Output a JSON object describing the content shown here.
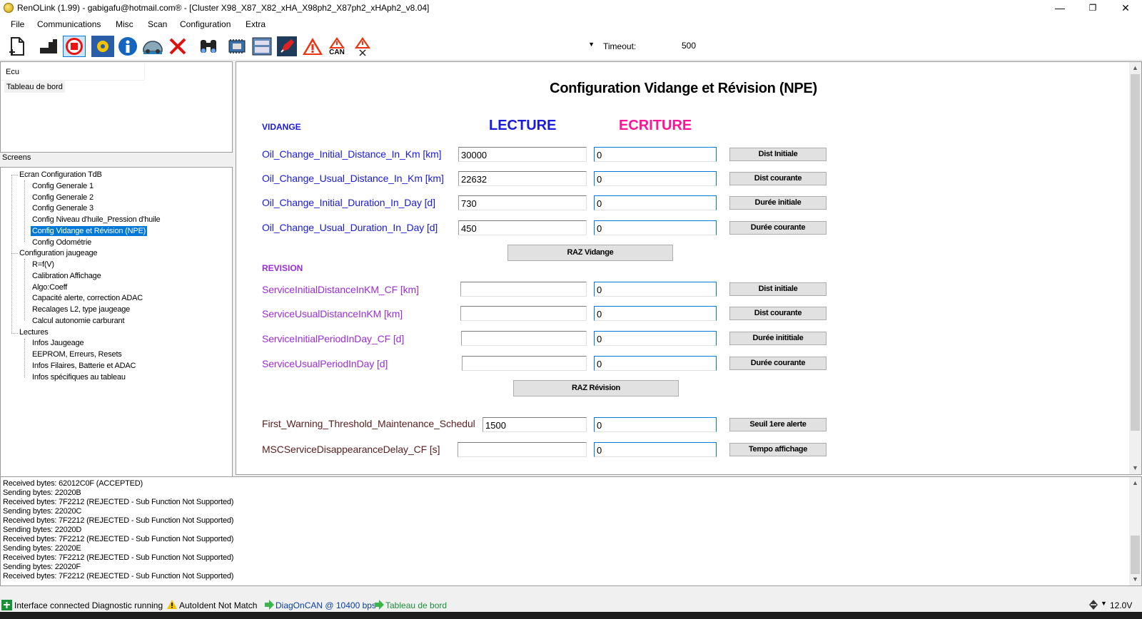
{
  "window": {
    "title": "RenOLink (1.99) - gabigafu@hotmail.com® - [Cluster X98_X87_X82_xHA_X98ph2_X87ph2_xHAph2_v8.04]",
    "minimize": "—",
    "maximize": "❐",
    "close": "✕"
  },
  "menu": [
    "File",
    "Communications",
    "Misc",
    "Scan",
    "Configuration",
    "Extra"
  ],
  "toolbar": {
    "can_label": "CAN",
    "timeout_label": "Timeout:",
    "timeout_value": "500",
    "select_value": ""
  },
  "ecu": {
    "header": "Ecu",
    "row": "Tableau de bord"
  },
  "screens": {
    "label": "Screens",
    "tree": {
      "g1": "Ecran Configuration TdB",
      "g1_items": [
        "Config Generale 1",
        "Config Generale 2",
        "Config Generale 3",
        "Config Niveau d'huile_Pression d'huile",
        "Config Vidange et Révision (NPE)",
        "Config Odométrie"
      ],
      "g2": "Configuration jaugeage",
      "g2_items": [
        "R=f(V)",
        "Calibration Affichage",
        "Algo:Coeff",
        "Capacité alerte, correction ADAC",
        "Recalages L2, type jaugeage",
        "Calcul autonomie carburant"
      ],
      "g3": "Lectures",
      "g3_items": [
        "Infos Jaugeage",
        "EEPROM, Erreurs, Resets",
        "Infos Filaires, Batterie et ADAC",
        "Infos spécifiques au tableau"
      ]
    }
  },
  "form": {
    "title": "Configuration Vidange et Révision (NPE)",
    "vidange_label": "VIDANGE",
    "lecture": "LECTURE",
    "ecriture": "ECRITURE",
    "revision_label": "REVISION",
    "oil": [
      {
        "name": "Oil_Change_Initial_Distance_In_Km [km]",
        "read": "30000",
        "write": "0",
        "button": "Dist Initiale"
      },
      {
        "name": "Oil_Change_Usual_Distance_In_Km [km]",
        "read": "22632",
        "write": "0",
        "button": "Dist courante"
      },
      {
        "name": "Oil_Change_Initial_Duration_In_Day [d]",
        "read": "730",
        "write": "0",
        "button": "Durée initiale"
      },
      {
        "name": "Oil_Change_Usual_Duration_In_Day [d]",
        "read": "450",
        "write": "0",
        "button": "Durée courante"
      }
    ],
    "raz_vidange": "RAZ Vidange",
    "service": [
      {
        "name": "ServiceInitialDistanceInKM_CF [km]",
        "read": "",
        "write": "0",
        "button": "Dist initiale"
      },
      {
        "name": "ServiceUsualDistanceInKM [km]",
        "read": "",
        "write": "0",
        "button": "Dist courante"
      },
      {
        "name": "ServiceInitialPeriodInDay_CF [d]",
        "read": "",
        "write": "0",
        "button": "Durée inititiale"
      },
      {
        "name": "ServiceUsualPeriodInDay [d]",
        "read": "",
        "write": "0",
        "button": "Durée courante"
      }
    ],
    "raz_revision": "RAZ Révision",
    "other": [
      {
        "name": "First_Warning_Threshold_Maintenance_Schedul",
        "read": "1500",
        "write": "0",
        "button": "Seuil 1ere alerte"
      },
      {
        "name": "MSCServiceDisappearanceDelay_CF [s]",
        "read": "",
        "write": "0",
        "button": "Tempo affichage"
      }
    ]
  },
  "log": [
    "Received bytes: 62012C0F (ACCEPTED)",
    "Sending bytes: 22020B",
    "Received bytes: 7F2212 (REJECTED - Sub Function Not Supported)",
    "Sending bytes: 22020C",
    "Received bytes: 7F2212 (REJECTED - Sub Function Not Supported)",
    "Sending bytes: 22020D",
    "Received bytes: 7F2212 (REJECTED - Sub Function Not Supported)",
    "Sending bytes: 22020E",
    "Received bytes: 7F2212 (REJECTED - Sub Function Not Supported)",
    "Sending bytes: 22020F",
    "Received bytes: 7F2212 (REJECTED - Sub Function Not Supported)"
  ],
  "status": {
    "interface": "Interface connected Diagnostic running",
    "autoident": "AutoIdent Not Match",
    "diag": "DiagOnCAN @ 10400 bps",
    "ecu": "Tableau de bord",
    "voltage": "12.0V"
  },
  "colors": {
    "lecture": "#1a1adc",
    "ecriture": "#ff1493",
    "vidange": "#1a1adc",
    "revision": "#9b2fd6",
    "oil_param": "#1a1adc",
    "service_param": "#9b2fd6",
    "other_param": "#5a1e1e",
    "selection": "#0078d7"
  }
}
